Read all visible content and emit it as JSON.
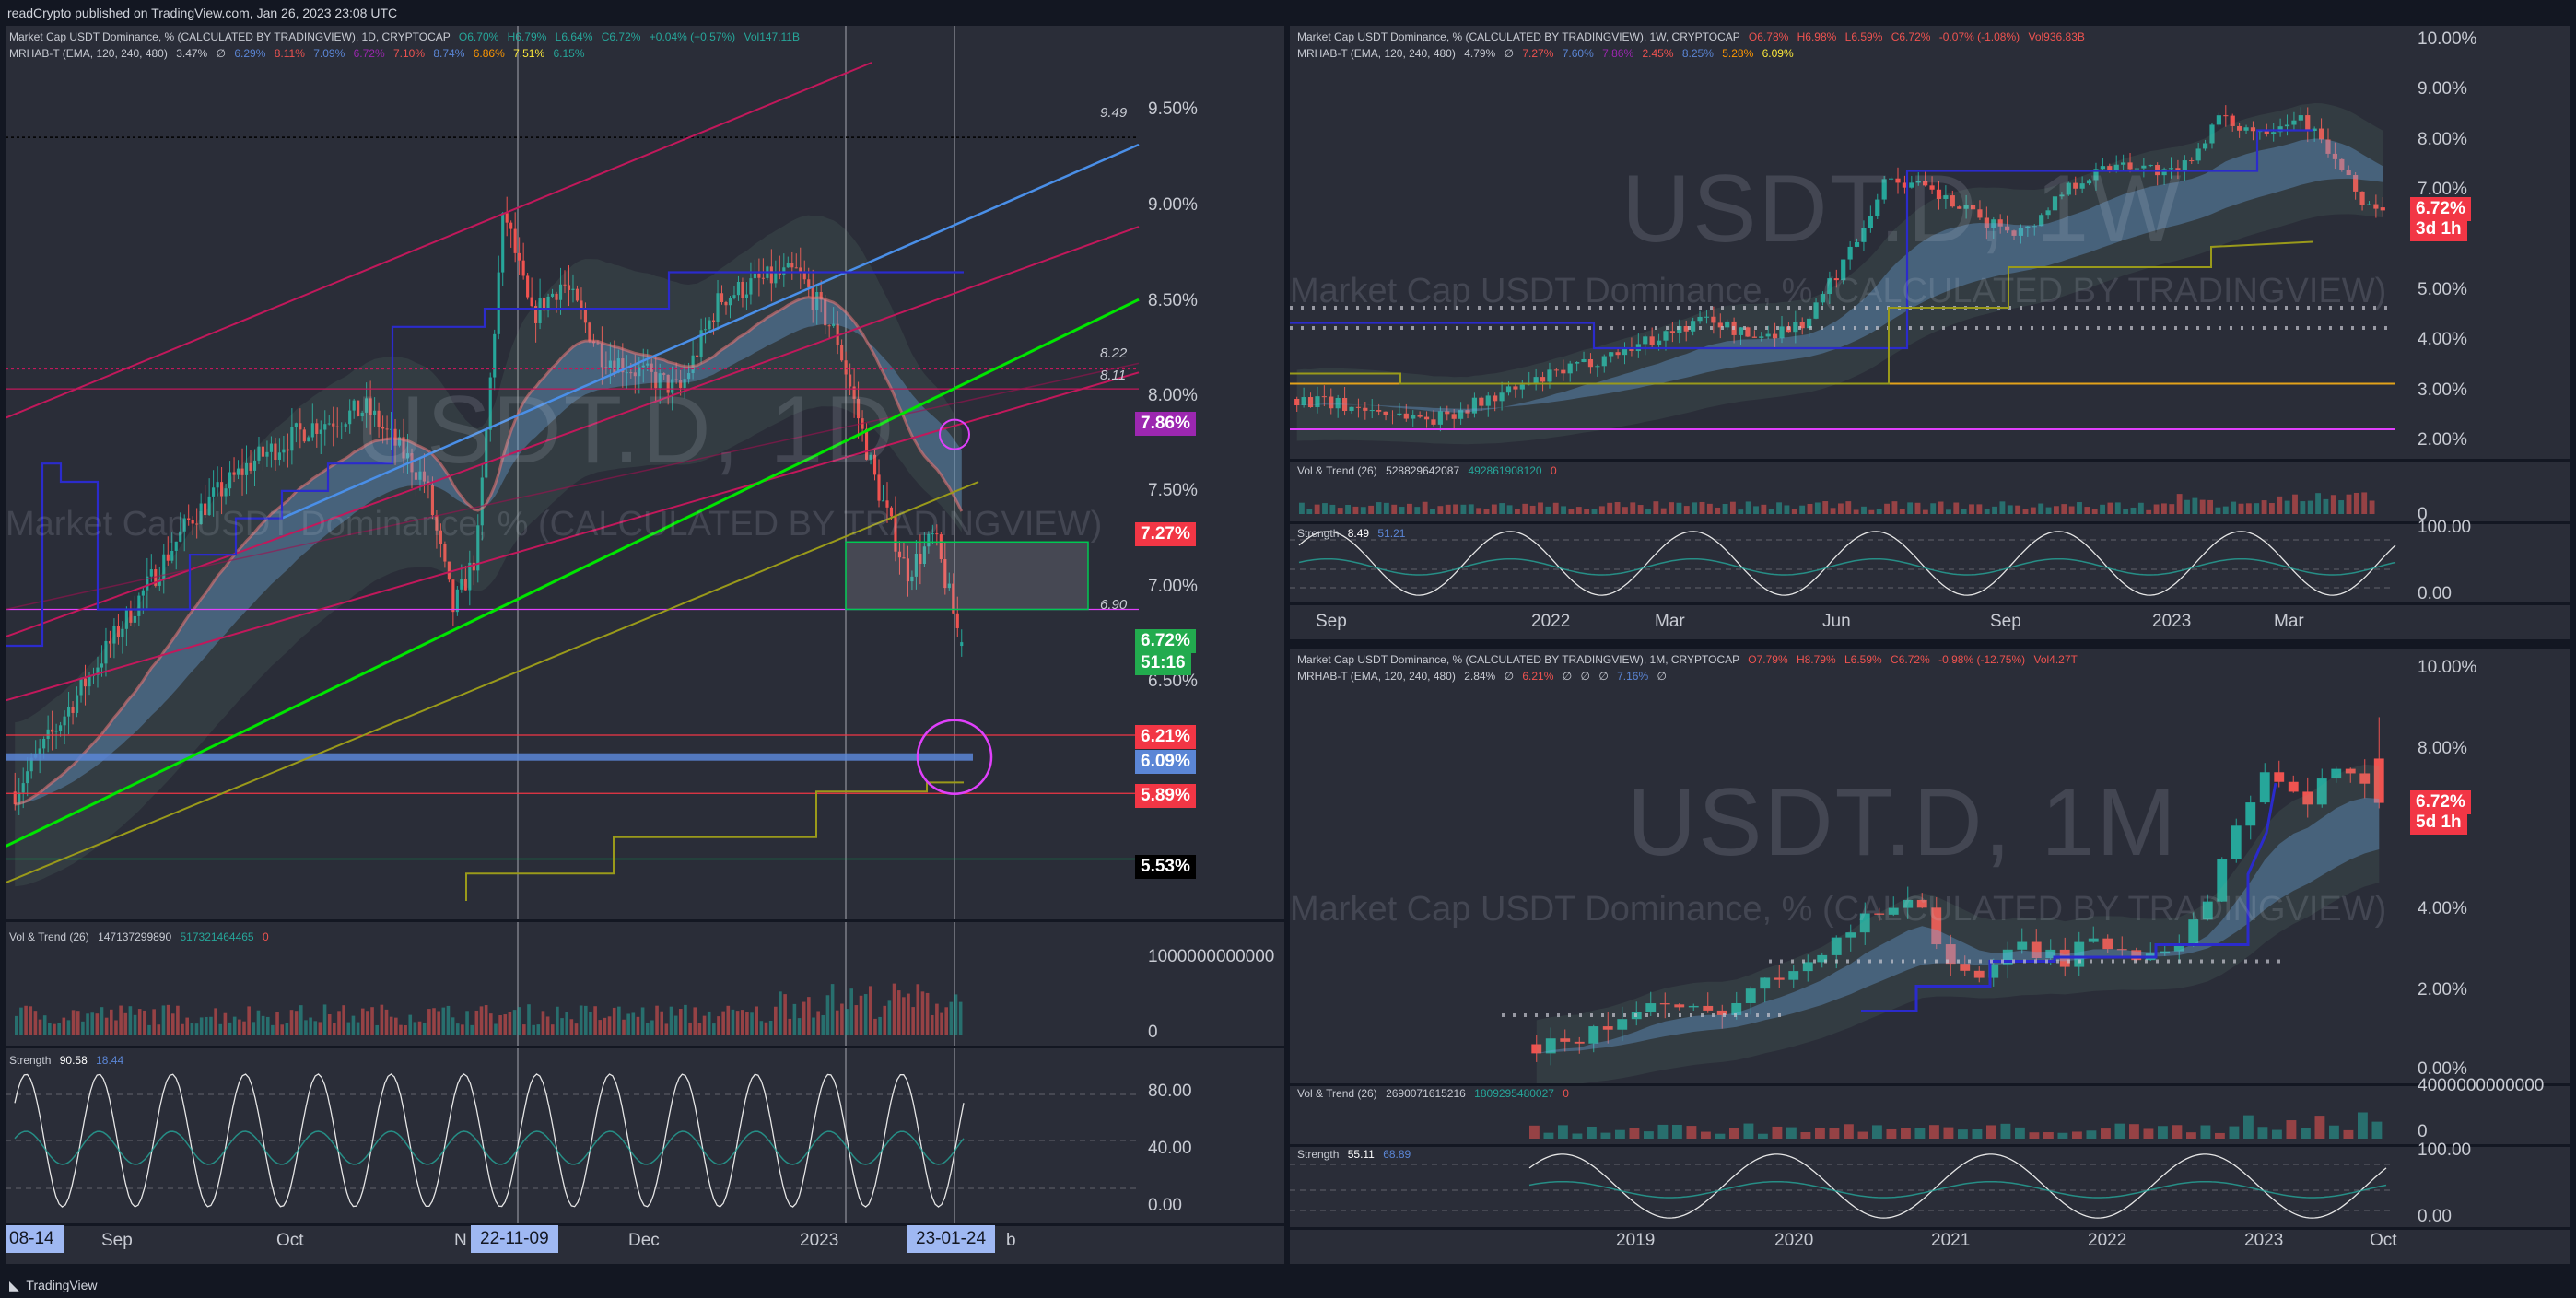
{
  "header": {
    "text": "readCrypto published on TradingView.com, Jan 26, 2023 23:08 UTC"
  },
  "footer": {
    "brand": "TradingView"
  },
  "colors": {
    "up": "#26a69a",
    "down": "#ef5350",
    "panel": "#2a2d38",
    "bg": "#131722",
    "green_line": "#00e600",
    "blue_line": "#4a8fe8",
    "crimson_line": "#c2185b",
    "olive": "#9a9a1a",
    "navy": "#2b2bcc",
    "magenta": "#e040fb"
  },
  "daily": {
    "legend1": {
      "title": "Market Cap USDT Dominance, % (CALCULATED BY TRADINGVIEW), 1D, CRYPTOCAP",
      "o": "O6.70%",
      "h": "H6.79%",
      "l": "L6.64%",
      "c": "C6.72%",
      "chg": "+0.04% (+0.57%)",
      "vol": "Vol147.11B"
    },
    "legend2": {
      "name": "MRHAB-T (EMA, 120, 240, 480)",
      "vals": [
        "3.47%",
        "∅",
        "6.29%",
        "8.11%",
        "7.09%",
        "6.72%",
        "7.10%",
        "8.74%",
        "6.86%",
        "7.51%",
        "6.15%"
      ]
    },
    "watermark": "USDT.D, 1D",
    "watermark_sub": "Market Cap USDT Dominance, % (CALCULATED BY TRADINGVIEW)",
    "y_ticks": [
      "9.50%",
      "9.00%",
      "8.50%",
      "8.00%",
      "7.50%",
      "7.00%",
      "6.50%"
    ],
    "level_labels": [
      "9.49",
      "8.22",
      "8.11",
      "6.90"
    ],
    "tags": [
      {
        "text": "7.86%",
        "color": "#9c27b0"
      },
      {
        "text": "7.27%",
        "color": "#f23645"
      },
      {
        "text": "6.72%",
        "color": "#22ab4e"
      },
      {
        "text": "51:16",
        "color": "#22ab4e"
      },
      {
        "text": "6.21%",
        "color": "#f23645"
      },
      {
        "text": "6.09%",
        "color": "#5b86d6"
      },
      {
        "text": "5.89%",
        "color": "#f23645"
      },
      {
        "text": "5.53%",
        "color": "#000000"
      }
    ],
    "vol_legend": {
      "name": "Vol & Trend (26)",
      "v1": "147137299890",
      "v2": "517321464465",
      "v3": "0"
    },
    "vol_ticks": [
      "1000000000000",
      "0"
    ],
    "str_legend": {
      "name": "Strength",
      "v1": "90.58",
      "v2": "18.44"
    },
    "str_ticks": [
      "80.00",
      "40.00",
      "0.00"
    ],
    "x_labels": [
      "08-14",
      "Sep",
      "Oct",
      "N",
      "22-11-09",
      "Dec",
      "2023",
      "23-01-24",
      "b"
    ]
  },
  "weekly": {
    "legend1": {
      "title": "Market Cap USDT Dominance, % (CALCULATED BY TRADINGVIEW), 1W, CRYPTOCAP",
      "o": "O6.78%",
      "h": "H6.98%",
      "l": "L6.59%",
      "c": "C6.72%",
      "chg": "-0.07% (-1.08%)",
      "vol": "Vol936.83B"
    },
    "legend2": {
      "name": "MRHAB-T (EMA, 120, 240, 480)",
      "vals": [
        "4.79%",
        "∅",
        "7.27%",
        "7.60%",
        "7.86%",
        "2.45%",
        "8.25%",
        "5.28%",
        "6.09%"
      ]
    },
    "watermark": "USDT.D, 1W",
    "watermark_sub": "Market Cap USDT Dominance, % (CALCULATED BY TRADINGVIEW)",
    "y_ticks": [
      "10.00%",
      "9.00%",
      "8.00%",
      "7.00%",
      "5.00%",
      "4.00%",
      "3.00%",
      "2.00%"
    ],
    "tag_price": "6.72%",
    "tag_time": "3d 1h",
    "vol_legend": {
      "name": "Vol & Trend (26)",
      "v1": "528829642087",
      "v2": "492861908120",
      "v3": "0"
    },
    "vol_ticks": [
      "0"
    ],
    "str_legend": {
      "name": "Strength",
      "v1": "8.49",
      "v2": "51.21"
    },
    "str_ticks": [
      "100.00",
      "0.00"
    ],
    "x_labels": [
      "Sep",
      "2022",
      "Mar",
      "Jun",
      "Sep",
      "2023",
      "Mar"
    ]
  },
  "monthly": {
    "legend1": {
      "title": "Market Cap USDT Dominance, % (CALCULATED BY TRADINGVIEW), 1M, CRYPTOCAP",
      "o": "O7.79%",
      "h": "H8.79%",
      "l": "L6.59%",
      "c": "C6.72%",
      "chg": "-0.98% (-12.75%)",
      "vol": "Vol4.27T"
    },
    "legend2": {
      "name": "MRHAB-T (EMA, 120, 240, 480)",
      "vals": [
        "2.84%",
        "∅",
        "6.21%",
        "∅",
        "∅",
        "∅",
        "7.16%",
        "∅"
      ]
    },
    "watermark": "USDT.D, 1M",
    "watermark_sub": "Market Cap USDT Dominance, % (CALCULATED BY TRADINGVIEW)",
    "y_ticks": [
      "10.00%",
      "8.00%",
      "4.00%",
      "2.00%",
      "0.00%"
    ],
    "tag_price": "6.72%",
    "tag_time": "5d 1h",
    "vol_legend": {
      "name": "Vol & Trend (26)",
      "v1": "2690071615216",
      "v2": "1809295480027",
      "v3": "0"
    },
    "vol_ticks": [
      "4000000000000",
      "0"
    ],
    "str_legend": {
      "name": "Strength",
      "v1": "55.11",
      "v2": "68.89"
    },
    "str_ticks": [
      "100.00",
      "0.00"
    ],
    "x_labels": [
      "2019",
      "2020",
      "2021",
      "2022",
      "2023",
      "Oct"
    ]
  },
  "chart_data": [
    {
      "type": "candlestick",
      "title": "Market Cap USDT Dominance, % (CALCULATED BY TRADINGVIEW), 1D, CRYPTOCAP",
      "ylabel": "%",
      "ylim": [
        5.3,
        9.9
      ],
      "x_ticks": [
        "Sep",
        "Oct",
        "Nov",
        "Dec",
        "2023"
      ],
      "close_path": [
        [
          0,
          5.9
        ],
        [
          15,
          6.4
        ],
        [
          30,
          6.9
        ],
        [
          45,
          7.4
        ],
        [
          60,
          7.7
        ],
        [
          75,
          7.9
        ],
        [
          90,
          8.0
        ],
        [
          105,
          7.6
        ],
        [
          112,
          6.9
        ],
        [
          118,
          7.2
        ],
        [
          125,
          9.1
        ],
        [
          132,
          8.5
        ],
        [
          140,
          8.7
        ],
        [
          150,
          8.3
        ],
        [
          160,
          8.2
        ],
        [
          170,
          8.1
        ],
        [
          180,
          8.6
        ],
        [
          190,
          8.7
        ],
        [
          200,
          8.75
        ],
        [
          210,
          8.4
        ],
        [
          220,
          7.6
        ],
        [
          228,
          7.1
        ],
        [
          235,
          7.3
        ],
        [
          242,
          6.7
        ]
      ],
      "last": {
        "o": 6.7,
        "h": 6.79,
        "l": 6.64,
        "c": 6.72
      },
      "levels": [
        9.49,
        8.22,
        8.11,
        7.86,
        7.27,
        6.9,
        6.21,
        6.09,
        5.89,
        5.53
      ],
      "volume_axis": [
        0,
        1000000000000
      ],
      "strength_axis": [
        0,
        80
      ]
    },
    {
      "type": "candlestick",
      "title": "Market Cap USDT Dominance, % (CALCULATED BY TRADINGVIEW), 1W, CRYPTOCAP",
      "ylabel": "%",
      "ylim": [
        2.0,
        10.0
      ],
      "x_ticks": [
        "Sep",
        "2022",
        "Mar",
        "Jun",
        "Sep",
        "2023",
        "Mar"
      ],
      "close_path": [
        [
          0,
          3.0
        ],
        [
          10,
          2.8
        ],
        [
          20,
          2.6
        ],
        [
          30,
          3.1
        ],
        [
          40,
          3.6
        ],
        [
          50,
          4.1
        ],
        [
          60,
          4.6
        ],
        [
          66,
          4.2
        ],
        [
          74,
          4.5
        ],
        [
          80,
          5.8
        ],
        [
          86,
          7.4
        ],
        [
          92,
          7.1
        ],
        [
          100,
          6.5
        ],
        [
          106,
          6.3
        ],
        [
          112,
          7.2
        ],
        [
          120,
          7.7
        ],
        [
          128,
          7.4
        ],
        [
          134,
          8.5
        ],
        [
          140,
          8.3
        ],
        [
          146,
          8.6
        ],
        [
          150,
          7.9
        ],
        [
          155,
          6.9
        ],
        [
          158,
          6.72
        ]
      ],
      "last": {
        "o": 6.78,
        "h": 6.98,
        "l": 6.59,
        "c": 6.72
      }
    },
    {
      "type": "candlestick",
      "title": "Market Cap USDT Dominance, % (CALCULATED BY TRADINGVIEW), 1M, CRYPTOCAP",
      "ylabel": "%",
      "ylim": [
        0.0,
        10.0
      ],
      "x_ticks": [
        "2019",
        "2020",
        "2021",
        "2022",
        "2023",
        "Oct"
      ],
      "close_path": [
        [
          0,
          0.9
        ],
        [
          6,
          1.2
        ],
        [
          12,
          1.8
        ],
        [
          18,
          1.6
        ],
        [
          24,
          2.3
        ],
        [
          30,
          3.2
        ],
        [
          36,
          4.0
        ],
        [
          40,
          4.6
        ],
        [
          44,
          2.9
        ],
        [
          48,
          2.5
        ],
        [
          52,
          3.3
        ],
        [
          56,
          2.9
        ],
        [
          60,
          3.4
        ],
        [
          64,
          3.1
        ],
        [
          70,
          3.6
        ],
        [
          74,
          5.8
        ],
        [
          78,
          7.6
        ],
        [
          82,
          6.5
        ],
        [
          86,
          7.9
        ],
        [
          90,
          6.72
        ]
      ],
      "last": {
        "o": 7.79,
        "h": 8.79,
        "l": 6.59,
        "c": 6.72
      }
    }
  ]
}
